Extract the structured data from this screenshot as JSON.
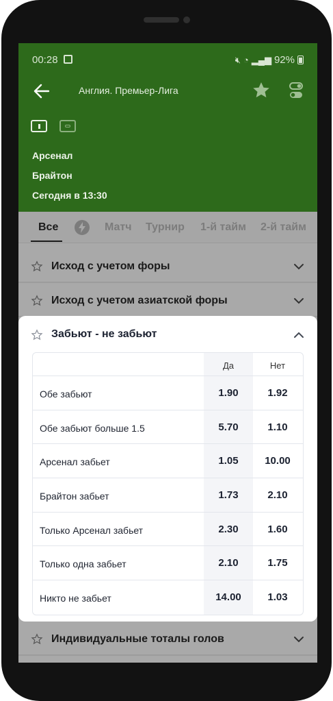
{
  "status_bar": {
    "time": "00:28",
    "battery": "92%"
  },
  "toolbar": {
    "title": "Англия. Премьер-Лига"
  },
  "match": {
    "team_home": "Арсенал",
    "team_away": "Брайтон",
    "start": "Сегодня в 13:30"
  },
  "tabs": [
    {
      "label": "Все",
      "active": true
    },
    {
      "label": "Матч"
    },
    {
      "label": "Турнир"
    },
    {
      "label": "1-й тайм"
    },
    {
      "label": "2-й тайм"
    }
  ],
  "markets": {
    "handicap": "Исход с учетом форы",
    "asian_handicap": "Исход с учетом азиатской форы",
    "individual_totals": "Индивидуальные тоталы голов"
  },
  "btts": {
    "title": "Забьют - не забьют",
    "col_yes": "Да",
    "col_no": "Нет",
    "rows": [
      {
        "label": "Обе забьют",
        "yes": "1.90",
        "no": "1.92"
      },
      {
        "label": "Обе забьют больше 1.5",
        "yes": "5.70",
        "no": "1.10"
      },
      {
        "label": "Арсенал забьет",
        "yes": "1.05",
        "no": "10.00"
      },
      {
        "label": "Брайтон забьет",
        "yes": "1.73",
        "no": "2.10"
      },
      {
        "label": "Только Арсенал забьет",
        "yes": "2.30",
        "no": "1.60"
      },
      {
        "label": "Только одна забьет",
        "yes": "2.10",
        "no": "1.75"
      },
      {
        "label": "Никто не забьет",
        "yes": "14.00",
        "no": "1.03"
      }
    ]
  },
  "colors": {
    "header_green": "#2d6a1b",
    "overlay_gray": "#a9a9a9",
    "card_bg": "#ffffff"
  }
}
